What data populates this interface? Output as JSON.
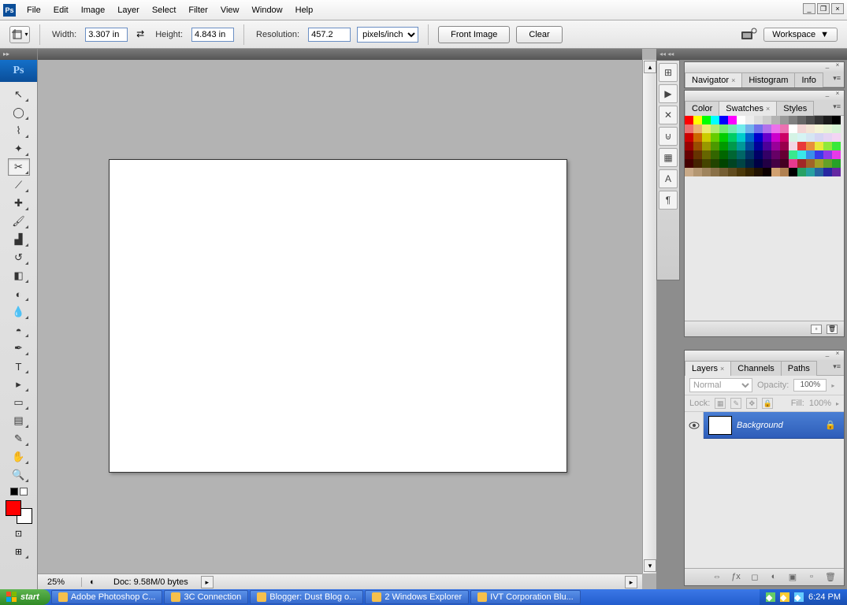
{
  "menu": {
    "items": [
      "File",
      "Edit",
      "Image",
      "Layer",
      "Select",
      "Filter",
      "View",
      "Window",
      "Help"
    ]
  },
  "window_controls": {
    "minimize": "_",
    "restore": "❐",
    "close": "×"
  },
  "options": {
    "width_label": "Width:",
    "width_value": "3.307 in",
    "height_label": "Height:",
    "height_value": "4.843 in",
    "resolution_label": "Resolution:",
    "resolution_value": "457.2",
    "unit_options": "pixels/inch",
    "front_image": "Front Image",
    "clear": "Clear",
    "workspace": "Workspace"
  },
  "toolbox": {
    "ps_label": "Ps",
    "tools": [
      {
        "name": "move-tool",
        "glyph": "↖"
      },
      {
        "name": "marquee-tool",
        "glyph": "◯"
      },
      {
        "name": "lasso-tool",
        "glyph": "⌇"
      },
      {
        "name": "wand-tool",
        "glyph": "✦"
      },
      {
        "name": "crop-tool",
        "glyph": "✂",
        "selected": true
      },
      {
        "name": "slice-tool",
        "glyph": "⟋"
      },
      {
        "name": "heal-tool",
        "glyph": "✚"
      },
      {
        "name": "brush-tool",
        "glyph": "🖌"
      },
      {
        "name": "stamp-tool",
        "glyph": "▟"
      },
      {
        "name": "history-brush-tool",
        "glyph": "↺"
      },
      {
        "name": "eraser-tool",
        "glyph": "◧"
      },
      {
        "name": "gradient-tool",
        "glyph": "◐"
      },
      {
        "name": "blur-tool",
        "glyph": "💧"
      },
      {
        "name": "dodge-tool",
        "glyph": "◓"
      },
      {
        "name": "pen-tool",
        "glyph": "✒"
      },
      {
        "name": "type-tool",
        "glyph": "T"
      },
      {
        "name": "path-select-tool",
        "glyph": "▸"
      },
      {
        "name": "shape-tool",
        "glyph": "▭"
      },
      {
        "name": "notes-tool",
        "glyph": "▤"
      },
      {
        "name": "eyedropper-tool",
        "glyph": "✎"
      },
      {
        "name": "hand-tool",
        "glyph": "✋"
      },
      {
        "name": "zoom-tool",
        "glyph": "🔍"
      }
    ],
    "quickmask": "⊡",
    "screenmode": "⊞"
  },
  "status": {
    "zoom": "25%",
    "doc": "Doc: 9.58M/0 bytes"
  },
  "panels": {
    "nav_tabs": [
      "Navigator",
      "Histogram",
      "Info"
    ],
    "color_tabs": [
      "Color",
      "Swatches",
      "Styles"
    ],
    "layer_tabs": [
      "Layers",
      "Channels",
      "Paths"
    ],
    "opacity_label": "Opacity:",
    "opacity_value": "100%",
    "fill_label": "Fill:",
    "fill_value": "100%",
    "blend_mode": "Normal",
    "lock_label": "Lock:",
    "background_layer": "Background"
  },
  "swatches": [
    "#ff0000",
    "#ffff00",
    "#00ff00",
    "#00ffff",
    "#0000ff",
    "#ff00ff",
    "#ffffff",
    "#ededed",
    "#dcdcdc",
    "#cccccc",
    "#b3b3b3",
    "#999999",
    "#808080",
    "#666666",
    "#4d4d4d",
    "#333333",
    "#1a1a1a",
    "#000000",
    "#eb7171",
    "#ebb171",
    "#ebeb71",
    "#b1eb71",
    "#71eb71",
    "#71ebb1",
    "#71ebeb",
    "#71b1eb",
    "#7171eb",
    "#b171eb",
    "#eb71eb",
    "#eb71b1",
    "#ffffff",
    "#f3d5d5",
    "#f3e5d5",
    "#f3f3d5",
    "#e5f3d5",
    "#d5f3d5",
    "#cc0000",
    "#cc6600",
    "#cccc00",
    "#66cc00",
    "#00cc00",
    "#00cc66",
    "#00cccc",
    "#0066cc",
    "#0000cc",
    "#6600cc",
    "#cc00cc",
    "#cc0066",
    "#d5f3e5",
    "#d5f3f3",
    "#d5e5f3",
    "#d5d5f3",
    "#e5d5f3",
    "#f3d5f3",
    "#990000",
    "#994c00",
    "#999900",
    "#4c9900",
    "#009900",
    "#00994c",
    "#009999",
    "#004c99",
    "#000099",
    "#4c0099",
    "#990099",
    "#99004c",
    "#f3d5e5",
    "#e83a3a",
    "#e88f3a",
    "#e8e83a",
    "#8fe83a",
    "#3ae83a",
    "#660000",
    "#663300",
    "#666600",
    "#336600",
    "#006600",
    "#006633",
    "#006666",
    "#003366",
    "#000066",
    "#330066",
    "#660066",
    "#660033",
    "#3ae88f",
    "#3ae8e8",
    "#3a8fe8",
    "#3a3ae8",
    "#8f3ae8",
    "#e83ae8",
    "#440000",
    "#442200",
    "#444400",
    "#224400",
    "#004400",
    "#004422",
    "#004444",
    "#002244",
    "#000044",
    "#220044",
    "#440044",
    "#440022",
    "#e83a8f",
    "#a12727",
    "#a16427",
    "#a1a127",
    "#64a127",
    "#27a127",
    "#c9aa88",
    "#b49772",
    "#9f845d",
    "#8a7148",
    "#755e33",
    "#604b1e",
    "#4b3809",
    "#362500",
    "#211200",
    "#0c0000",
    "#d0a070",
    "#b08050",
    "#000000",
    "#27a164",
    "#27a1a1",
    "#2764a1",
    "#2727a1",
    "#6427a1"
  ],
  "dock_icons": [
    "⊞",
    "▶",
    "✕",
    "⊍",
    "▦",
    "A",
    "¶"
  ],
  "taskbar": {
    "start": "start",
    "tasks": [
      {
        "name": "Adobe Photoshop C..."
      },
      {
        "name": "3C Connection"
      },
      {
        "name": "Blogger: Dust Blog o..."
      },
      {
        "name": "2 Windows Explorer"
      },
      {
        "name": "IVT Corporation Blu..."
      }
    ],
    "time": "6:24 PM"
  }
}
